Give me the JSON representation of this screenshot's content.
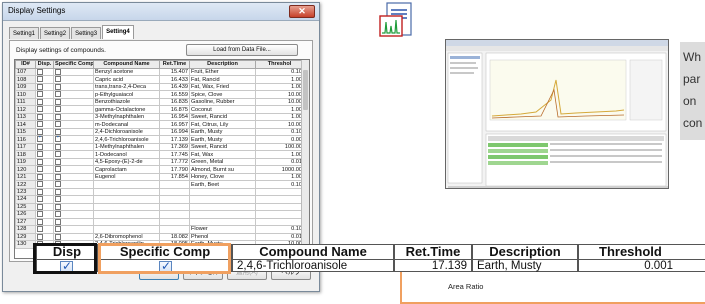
{
  "dialog": {
    "title": "Display Settings",
    "close_glyph": "✕",
    "tabs": [
      "Setting1",
      "Setting2",
      "Setting3",
      "Setting4"
    ],
    "active_tab": "Setting4",
    "description": "Display settings of compounds.",
    "load_button": "Load from Data File...",
    "columns": [
      "ID#",
      "Disp.",
      "Specific Comp.",
      "Compound Name",
      "Ret.Time",
      "Description",
      "Threshol"
    ],
    "rows": [
      {
        "id": "107",
        "disp": false,
        "spec": false,
        "name": "Benzyl acetone",
        "rt": "15.407",
        "desc": "Fruit, Ether",
        "thr": "0.10"
      },
      {
        "id": "108",
        "disp": false,
        "spec": false,
        "name": "Capric acid",
        "rt": "16.433",
        "desc": "Fat, Rancid",
        "thr": "1.00"
      },
      {
        "id": "109",
        "disp": false,
        "spec": false,
        "name": "trans,trans-2,4-Deca",
        "rt": "16.439",
        "desc": "Fat, Wax, Fried",
        "thr": "1.00"
      },
      {
        "id": "110",
        "disp": false,
        "spec": false,
        "name": "p-Ethylguaiacol",
        "rt": "16.559",
        "desc": "Spice, Clove",
        "thr": "10.00"
      },
      {
        "id": "111",
        "disp": false,
        "spec": false,
        "name": "Benzothiazole",
        "rt": "16.835",
        "desc": "Gasoline, Rubber",
        "thr": "10.00"
      },
      {
        "id": "112",
        "disp": false,
        "spec": false,
        "name": "gamma-Octalactone",
        "rt": "16.875",
        "desc": "Coconut",
        "thr": "1.00"
      },
      {
        "id": "113",
        "disp": false,
        "spec": false,
        "name": "3-Methylnaphthalen",
        "rt": "16.954",
        "desc": "Sweet, Rancid",
        "thr": "1.00"
      },
      {
        "id": "114",
        "disp": false,
        "spec": false,
        "name": "m-Dodecanal",
        "rt": "16.957",
        "desc": "Fat, Citrus, Lily",
        "thr": "10.00"
      },
      {
        "id": "115",
        "disp": false,
        "spec": false,
        "name": "2,4-Dichloroanisole",
        "rt": "16.994",
        "desc": "Earth, Musty",
        "thr": "0.10"
      },
      {
        "id": "116",
        "disp": true,
        "spec": true,
        "name": "2,4,6-Trichloroanisole",
        "rt": "17.139",
        "desc": "Earth, Musty",
        "thr": "0.00"
      },
      {
        "id": "117",
        "disp": false,
        "spec": false,
        "name": "1-Methylnaphthalen",
        "rt": "17.369",
        "desc": "Sweet, Rancid",
        "thr": "100.00"
      },
      {
        "id": "118",
        "disp": false,
        "spec": false,
        "name": "1-Dodecanol",
        "rt": "17.745",
        "desc": "Fat, Wax",
        "thr": "1.00"
      },
      {
        "id": "119",
        "disp": false,
        "spec": false,
        "name": "4,5-Epoxy-(E)-2-de",
        "rt": "17.772",
        "desc": "Green, Metal",
        "thr": "0.01"
      },
      {
        "id": "120",
        "disp": false,
        "spec": false,
        "name": "Caprolactam",
        "rt": "17.790",
        "desc": "Almond, Burnt su",
        "thr": "1000.00"
      },
      {
        "id": "121",
        "disp": false,
        "spec": false,
        "name": "Eugenol",
        "rt": "17.854",
        "desc": "Honey, Clove",
        "thr": "1.00"
      },
      {
        "id": "122",
        "disp": false,
        "spec": false,
        "name": "",
        "rt": "",
        "desc": "Earth, Beet",
        "thr": "0.10"
      },
      {
        "id": "123",
        "disp": false,
        "spec": false,
        "name": "",
        "rt": "",
        "desc": "",
        "thr": ""
      },
      {
        "id": "124",
        "disp": false,
        "spec": false,
        "name": "",
        "rt": "",
        "desc": "",
        "thr": ""
      },
      {
        "id": "125",
        "disp": false,
        "spec": false,
        "name": "",
        "rt": "",
        "desc": "",
        "thr": ""
      },
      {
        "id": "126",
        "disp": false,
        "spec": false,
        "name": "",
        "rt": "",
        "desc": "",
        "thr": ""
      },
      {
        "id": "127",
        "disp": false,
        "spec": false,
        "name": "",
        "rt": "",
        "desc": "",
        "thr": ""
      },
      {
        "id": "128",
        "disp": false,
        "spec": false,
        "name": "",
        "rt": "",
        "desc": "Flower",
        "thr": "0.10"
      },
      {
        "id": "129",
        "disp": false,
        "spec": false,
        "name": "2,6-Dibromophenol",
        "rt": "18.082",
        "desc": "Phenol",
        "thr": "0.01"
      },
      {
        "id": "130",
        "disp": false,
        "spec": false,
        "name": "2,4,6-Trichloroanilin",
        "rt": "18.095",
        "desc": "Earth, Musty",
        "thr": "10.00"
      }
    ],
    "buttons": {
      "ok": "OK",
      "cancel": "キャンセル",
      "apply": "適用(A)",
      "help": "ヘルプ"
    }
  },
  "zoom": {
    "disp_header": "Disp",
    "spec_header": "Specific Comp",
    "name_header": "Compound Name",
    "rt_header": "Ret.Time",
    "desc_header": "Description",
    "thr_header": "Threshold",
    "name_value": "2,4,6-Trichloroanisole",
    "rt_value": "17.139",
    "desc_value": "Earth, Musty",
    "thr_value": "0.001"
  },
  "info_box_lines": [
    "Wh",
    "par",
    "on",
    "con"
  ],
  "area_ratio_label": "Area Ratio",
  "colors": {
    "highlight_orange": "#f0a060",
    "highlight_black": "#111111",
    "checkmark": "#1f58b5"
  }
}
